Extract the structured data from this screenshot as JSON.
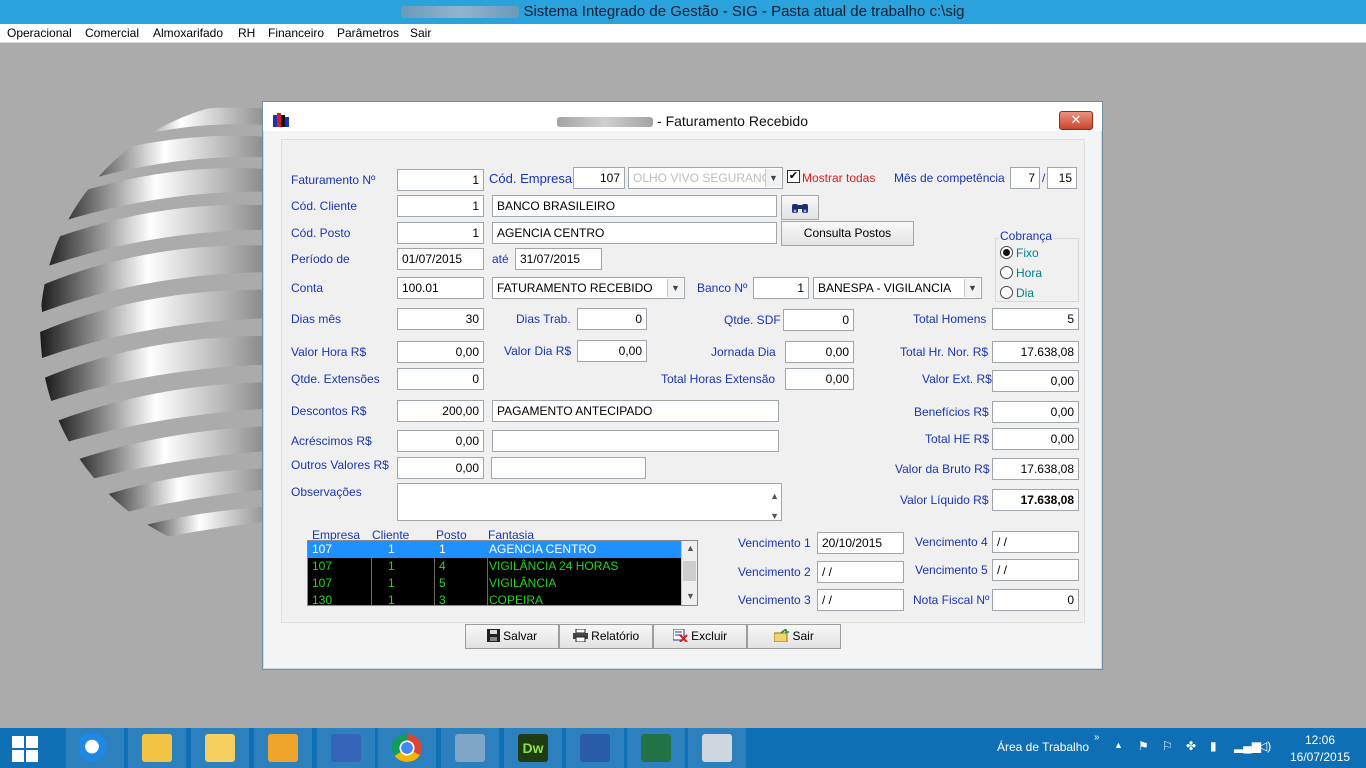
{
  "window": {
    "title_suffix": "Sistema Integrado de Gestão - SIG - Pasta atual de trabalho c:\\sig"
  },
  "menu": [
    "Operacional",
    "Comercial",
    "Almoxarifado",
    "RH",
    "Financeiro",
    "Parâmetros",
    "Sair"
  ],
  "dialog": {
    "title": "- Faturamento Recebido",
    "close_label": "✕"
  },
  "form": {
    "faturamento_label": "Faturamento Nº",
    "faturamento_value": "1",
    "cod_empresa_label": "Cód. Empresa",
    "cod_empresa_value": "107",
    "empresa_nome": "OLHO VIVO SEGURANÇ",
    "mostrar_todas_label": "Mostrar todas",
    "mostrar_todas_checked": "✔",
    "mes_competencia_label": "Mês de competência",
    "mes_value": "7",
    "mes_sep": "/",
    "ano_value": "15",
    "cod_cliente_label": "Cód. Cliente",
    "cod_cliente_value": "1",
    "cliente_nome": "BANCO BRASILEIRO",
    "cod_posto_label": "Cód. Posto",
    "cod_posto_value": "1",
    "posto_nome": "AGENCIA CENTRO",
    "consulta_postos_label": "Consulta Postos",
    "cobranca_label": "Cobrança",
    "cobranca_options": [
      "Fixo",
      "Hora",
      "Dia"
    ],
    "cobranca_selected": "Fixo",
    "periodo_label": "Período de",
    "periodo_de": "01/07/2015",
    "ate_label": "até",
    "periodo_ate": "31/07/2015",
    "conta_label": "Conta",
    "conta_value": "100.01",
    "conta_desc": "FATURAMENTO RECEBIDO",
    "banco_label": "Banco Nº",
    "banco_value": "1",
    "banco_nome": "BANESPA - VIGILANCIA",
    "dias_mes_label": "Dias mês",
    "dias_mes_value": "30",
    "dias_trab_label": "Dias Trab.",
    "dias_trab_value": "0",
    "qtde_sdf_label": "Qtde. SDF",
    "qtde_sdf_value": "0",
    "total_homens_label": "Total Homens",
    "total_homens_value": "5",
    "valor_hora_label": "Valor Hora R$",
    "valor_hora_value": "0,00",
    "valor_dia_label": "Valor Dia R$",
    "valor_dia_value": "0,00",
    "jornada_dia_label": "Jornada Dia",
    "jornada_dia_value": "0,00",
    "total_hr_nor_label": "Total Hr. Nor. R$",
    "total_hr_nor_value": "17.638,08",
    "qtde_extensoes_label": "Qtde. Extensões",
    "qtde_extensoes_value": "0",
    "total_horas_ext_label": "Total Horas Extensão",
    "total_horas_ext_value": "0,00",
    "valor_ext_label": "Valor Ext. R$",
    "valor_ext_value": "0,00",
    "descontos_label": "Descontos R$",
    "descontos_value": "200,00",
    "descontos_desc": "PAGAMENTO ANTECIPADO",
    "beneficios_label": "Benefícios R$",
    "beneficios_value": "0,00",
    "acrescimos_label": "Acréscimos R$",
    "acrescimos_value": "0,00",
    "acrescimos_desc": "",
    "total_he_label": "Total HE R$",
    "total_he_value": "0,00",
    "outros_label": "Outros Valores R$",
    "outros_value": "0,00",
    "outros_desc": "",
    "valor_bruto_label": "Valor da Bruto R$",
    "valor_bruto_value": "17.638,08",
    "observacoes_label": "Observações",
    "observacoes_value": "",
    "valor_liquido_label": "Valor Líquido R$",
    "valor_liquido_value": "17.638,08"
  },
  "grid": {
    "headers": [
      "Empresa",
      "Cliente",
      "Posto",
      "Fantasia"
    ],
    "rows": [
      {
        "empresa": "107",
        "cliente": "1",
        "posto": "1",
        "fantasia": "AGENCIA CENTRO"
      },
      {
        "empresa": "107",
        "cliente": "1",
        "posto": "4",
        "fantasia": "VIGILÂNCIA 24 HORAS"
      },
      {
        "empresa": "107",
        "cliente": "1",
        "posto": "5",
        "fantasia": "VIGILÂNCIA"
      },
      {
        "empresa": "130",
        "cliente": "1",
        "posto": "3",
        "fantasia": "COPEIRA"
      }
    ]
  },
  "vencimentos": {
    "v1_label": "Vencimento 1",
    "v1_value": "20/10/2015",
    "v2_label": "Vencimento 2",
    "v2_value": " / /",
    "v3_label": "Vencimento 3",
    "v3_value": " / /",
    "v4_label": "Vencimento 4",
    "v4_value": " / /",
    "v5_label": "Vencimento 5",
    "v5_value": " / /",
    "nota_fiscal_label": "Nota Fiscal Nº",
    "nota_fiscal_value": "0"
  },
  "buttons": {
    "salvar": "Salvar",
    "relatorio": "Relatório",
    "excluir": "Excluir",
    "sair": "Sair"
  },
  "taskbar": {
    "area_trabalho": "Área de Trabalho",
    "clock_time": "12:06",
    "clock_date": "16/07/2015"
  },
  "colors": {
    "label_blue": "#1a35b5",
    "grid_green": "#22d622",
    "grid_selection": "#1e90ff",
    "taskbar": "#0f6fb5",
    "titlebar": "#2aa2dc"
  }
}
